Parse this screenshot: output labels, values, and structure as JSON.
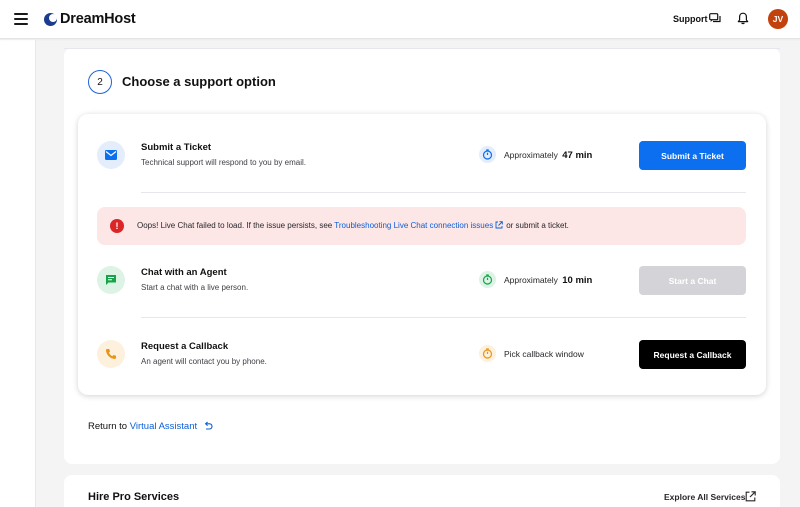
{
  "header": {
    "logo_text": "DreamHost",
    "support_label": "Support",
    "avatar_initials": "JV",
    "avatar_color": "#c2410c"
  },
  "step": {
    "number": "2",
    "title": "Choose a support option"
  },
  "options": [
    {
      "title": "Submit a Ticket",
      "description": "Technical support will respond to you by email.",
      "time_prefix": "Approximately",
      "time_value": "47 min",
      "button_label": "Submit a Ticket",
      "icon": "mail-icon"
    },
    {
      "title": "Chat with an Agent",
      "description": "Start a chat with a live person.",
      "time_prefix": "Approximately",
      "time_value": "10 min",
      "button_label": "Start a Chat",
      "icon": "chat-bubble-icon"
    },
    {
      "title": "Request a Callback",
      "description": "An agent will contact you by phone.",
      "time_prefix": "Pick callback window",
      "time_value": "",
      "button_label": "Request a Callback",
      "icon": "phone-icon"
    }
  ],
  "error_banner": {
    "text_before": "Oops! Live Chat failed to load. If the issue persists, see",
    "link_text": "Troubleshooting Live Chat connection issues",
    "text_after": "or submit a ticket."
  },
  "return": {
    "prefix": "Return to",
    "link_text": "Virtual Assistant"
  },
  "pro_services": {
    "title": "Hire Pro Services",
    "explore_label": "Explore All Services"
  },
  "colors": {
    "primary_blue": "#0b6ff0",
    "link_blue": "#0b5fd6",
    "error_bg": "#fde6e6",
    "error_red": "#dc2626",
    "disabled_gray": "#d4d4d8"
  }
}
